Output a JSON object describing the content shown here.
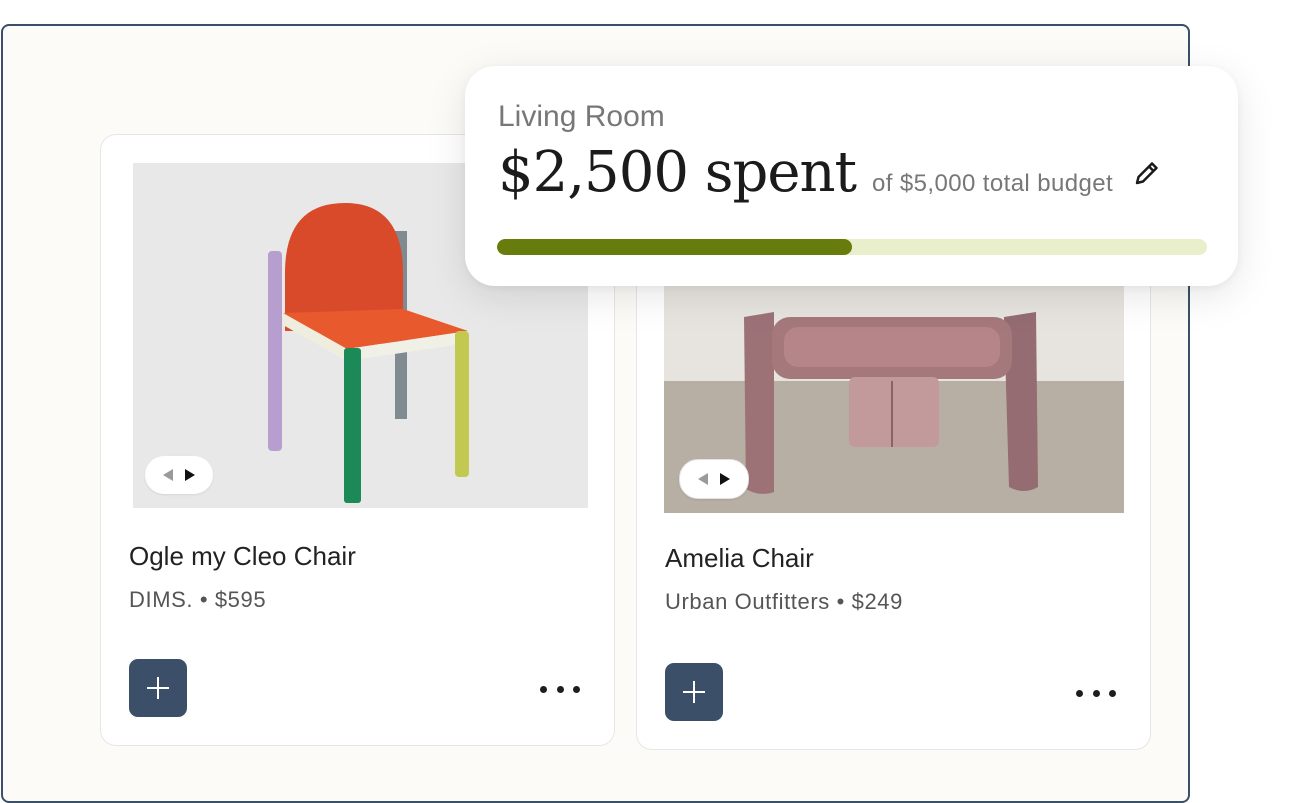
{
  "budget": {
    "room": "Living Room",
    "spent_label": "$2,500 spent",
    "total_label": "of $5,000 total budget",
    "progress_fraction": 0.5,
    "colors": {
      "fill": "#667c0c",
      "track": "#e9efcb"
    }
  },
  "cards": [
    {
      "title": "Ogle my Cleo Chair",
      "meta": "DIMS. • $595",
      "image": "multicolor-wooden-chair"
    },
    {
      "title": "Amelia Chair",
      "meta": "Urban Outfitters • $249",
      "image": "pink-velvet-armchair"
    }
  ],
  "icons": {
    "add": "plus-icon",
    "more": "more-horizontal-icon",
    "edit": "pencil-icon",
    "carousel_prev": "triangle-left-icon",
    "carousel_next": "triangle-right-icon"
  },
  "colors": {
    "accent": "#3b5068",
    "frame_bg": "#fcfbf7"
  }
}
